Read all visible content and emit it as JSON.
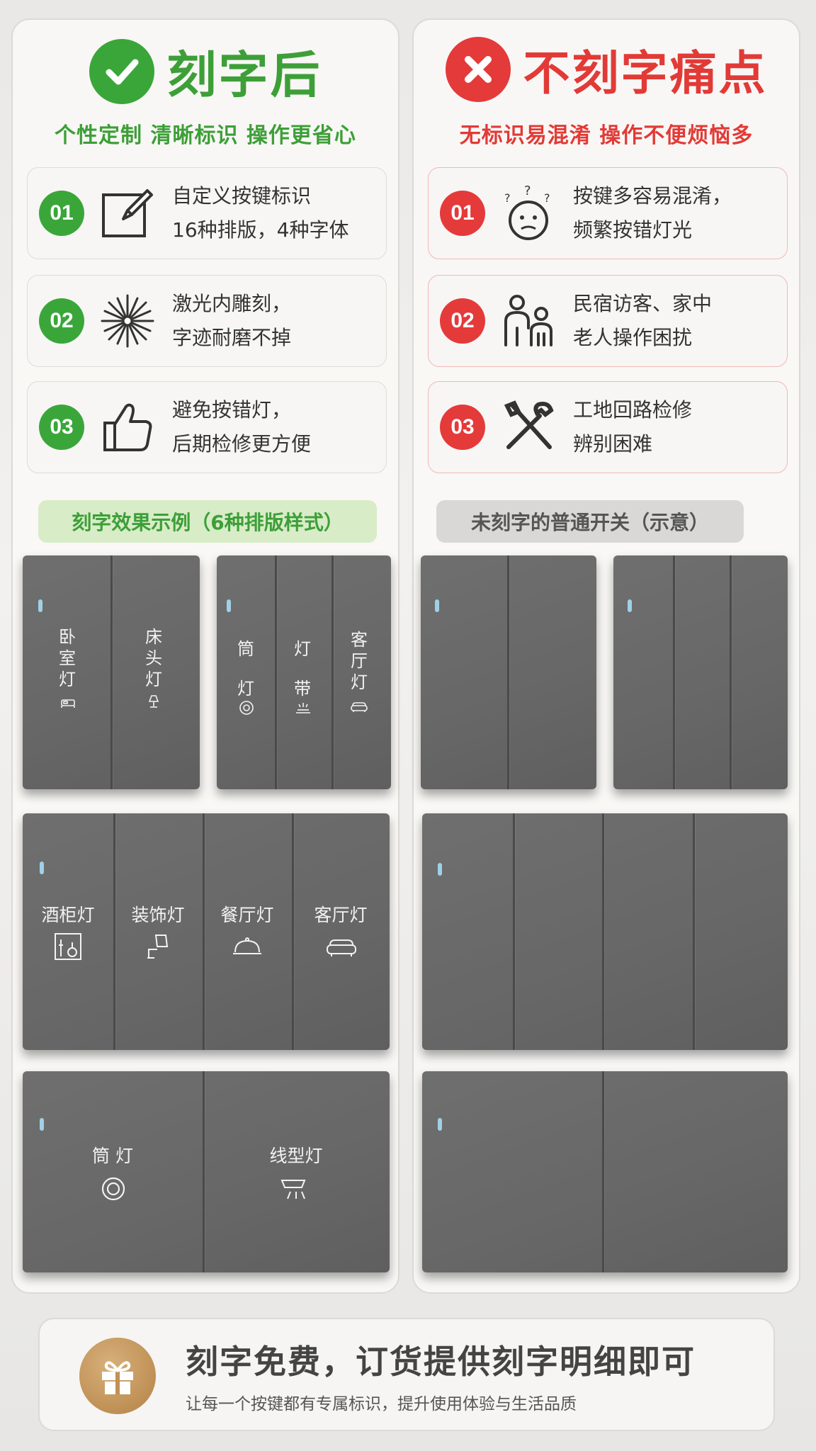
{
  "left": {
    "title": "刻字后",
    "subtitle": "个性定制 清晰标识 操作更省心",
    "items": [
      {
        "num": "01",
        "line1": "自定义按键标识",
        "line2": "16种排版，4种字体",
        "icon": "edit-icon"
      },
      {
        "num": "02",
        "line1": "激光内雕刻，",
        "line2": "字迹耐磨不掉",
        "icon": "laser-burst-icon"
      },
      {
        "num": "03",
        "line1": "避免按错灯，",
        "line2": "后期检修更方便",
        "icon": "thumbs-up-icon"
      }
    ],
    "pill": "刻字效果示例（6种排版样式）",
    "examples": {
      "p1": [
        {
          "label": "卧室灯",
          "icon": "bed-icon"
        },
        {
          "label": "床头灯",
          "icon": "lamp-icon"
        }
      ],
      "p2": [
        {
          "label": "筒灯",
          "icon": "downlight-icon"
        },
        {
          "label": "灯带",
          "icon": "light-strip-icon"
        },
        {
          "label": "客厅灯",
          "icon": "sofa-icon"
        }
      ],
      "p3": [
        {
          "label": "酒柜灯",
          "icon": "wine-cabinet-icon"
        },
        {
          "label": "装饰灯",
          "icon": "decor-lamp-icon"
        },
        {
          "label": "餐厅灯",
          "icon": "dining-cloche-icon"
        },
        {
          "label": "客厅灯",
          "icon": "sofa-icon"
        }
      ],
      "p4": [
        {
          "label": "筒 灯",
          "icon": "downlight-icon"
        },
        {
          "label": "线型灯",
          "icon": "linear-light-icon"
        }
      ]
    }
  },
  "right": {
    "title": "不刻字痛点",
    "subtitle": "无标识易混淆 操作不便烦恼多",
    "items": [
      {
        "num": "01",
        "line1": "按键多容易混淆，",
        "line2": "频繁按错灯光",
        "icon": "confused-face-icon"
      },
      {
        "num": "02",
        "line1": "民宿访客、家中",
        "line2": "老人操作困扰",
        "icon": "people-icon"
      },
      {
        "num": "03",
        "line1": "工地回路检修",
        "line2": "辨别困难",
        "icon": "tools-icon"
      }
    ],
    "pill": "未刻字的普通开关（示意）"
  },
  "footer": {
    "title": "刻字免费，订货提供刻字明细即可",
    "subtitle": "让每一个按键都有专属标识，提升使用体验与生活品质",
    "icon": "gift-icon"
  },
  "colors": {
    "green": "#3aa63a",
    "red": "#e43a3a",
    "panel": "#6a6a6a"
  }
}
